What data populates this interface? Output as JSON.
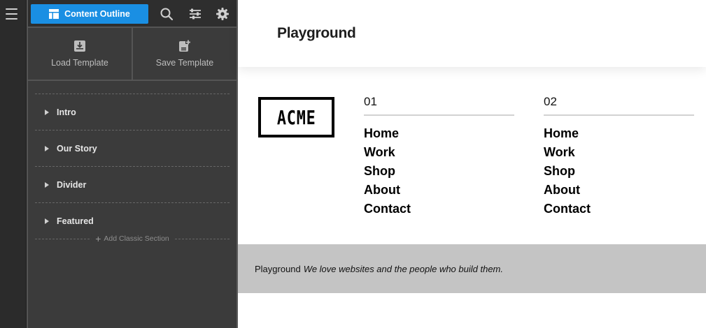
{
  "sidebar": {
    "outline_button": "Content Outline",
    "templates": {
      "load": "Load Template",
      "save": "Save Template"
    },
    "sections": [
      {
        "label": "Intro"
      },
      {
        "label": "Our Story"
      },
      {
        "label": "Divider"
      },
      {
        "label": "Featured"
      }
    ],
    "add_section": "Add Classic Section"
  },
  "site": {
    "title": "Playground",
    "logo_text": "ACME",
    "nav_columns": [
      {
        "number": "01",
        "links": [
          "Home",
          "Work",
          "Shop",
          "About",
          "Contact"
        ]
      },
      {
        "number": "02",
        "links": [
          "Home",
          "Work",
          "Shop",
          "About",
          "Contact"
        ]
      }
    ],
    "footer": {
      "brand": "Playground",
      "tagline": "We love websites and the people who build them."
    }
  },
  "colors": {
    "accent": "#1a8fe3",
    "panel": "#3b3b3b",
    "rail": "#2b2b2b",
    "footer": "#c4c4c4"
  },
  "icons": [
    "menu-icon",
    "layout-icon",
    "search-icon",
    "sliders-icon",
    "gear-icon",
    "download-icon",
    "save-template-icon",
    "caret-right-icon",
    "plus-icon"
  ]
}
